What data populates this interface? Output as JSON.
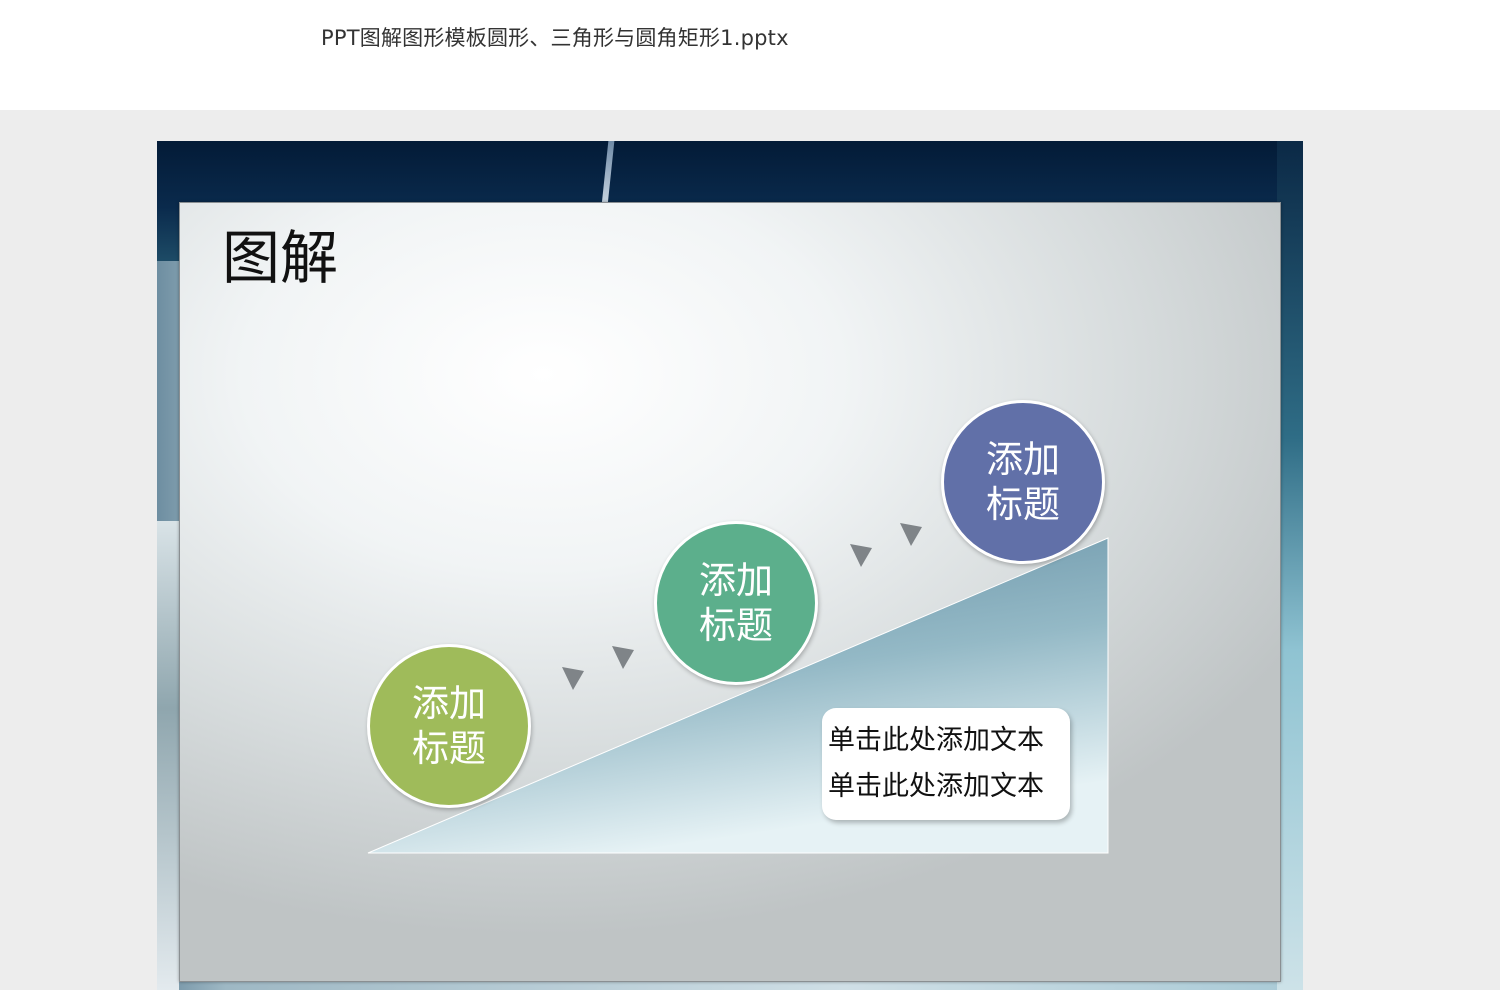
{
  "document": {
    "title": "PPT图解图形模板圆形、三角形与圆角矩形1.pptx"
  },
  "slide": {
    "heading": "图解",
    "steps": [
      {
        "line1": "添加",
        "line2": "标题",
        "color": "#9fbb5a"
      },
      {
        "line1": "添加",
        "line2": "标题",
        "color": "#5caf8c"
      },
      {
        "line1": "添加",
        "line2": "标题",
        "color": "#6170a8"
      }
    ],
    "textbox": {
      "line1": "单击此处添加文本",
      "line2": "单击此处添加文本"
    },
    "colors": {
      "triangle_top": "#5f8aa0",
      "triangle_bottom": "#e6f2f5",
      "arrow": "#7f8488"
    }
  }
}
